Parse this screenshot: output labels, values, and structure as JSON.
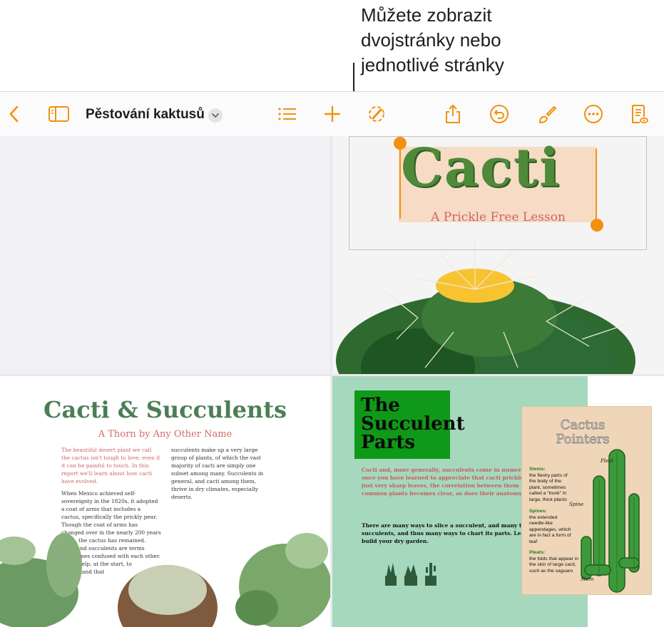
{
  "callout": {
    "lines": [
      "Můžete zobrazit",
      "dvojstránky nebo",
      "jednotlivé stránky"
    ]
  },
  "toolbar": {
    "title": "Pěstování kaktusů",
    "accent_color": "#f2910e",
    "icons": [
      "back-chevron-icon",
      "sidebar-icon",
      "chevron-down-icon",
      "list-icon",
      "plus-icon",
      "format-brush-icon",
      "share-icon",
      "undo-icon",
      "paintbrush-icon",
      "more-icon",
      "reading-view-icon"
    ]
  },
  "cover": {
    "title": "Cacti",
    "subtitle": "A Prickle Free Lesson"
  },
  "spread_left": {
    "title": "Cacti & Succulents",
    "subtitle": "A Thorn by Any Other Name",
    "intro": "The beautiful desert plant we call the cactus isn't tough to love, even if it can be painful to touch. In this report we'll learn about how cacti have evolved.",
    "col1": "When Mexico achieved self-sovereignty in the 1820s, it adopted a coat of arms that includes a cactus, specifically the prickly pear. Though the coat of arms has changed over in the nearly 200 years since, the cactus has remained. Cacti and succulents are terms sometimes confused with each other. It can help, at the start, to understand that",
    "col2": "succulents make up a very large group of plants, of which the vast majority of cacti are simply one subset among many. Succulents in general, and cacti among them, thrive in dry climates, especially deserts."
  },
  "spread_right": {
    "title_lines": [
      "The",
      "Succulent",
      "Parts"
    ],
    "intro": "Cacti and, more generally, succulents come in numerous forms, and, once you have learned to appreciate that cacti prickles are really just very sharp leaves, the correlation between them and more common plants becomes clear, as does their anatomy.",
    "body": "There are many ways to slice a succulent, and many types of succulents, and thus many ways to chart its parts. Learn how to build your dry garden.",
    "pointers": {
      "title_lines": [
        "Cactus",
        "Pointers"
      ],
      "items": [
        {
          "heading": "Stems:",
          "text": "the fleshy parts of the body of the plant, sometimes called a “trunk” in large, thick plants"
        },
        {
          "heading": "Spines:",
          "text": "the extended needle-like appendages, which are in fact a form of leaf"
        },
        {
          "heading": "Pleats:",
          "text": "the folds that appear in the skin of large cacti, such as the saguaro"
        }
      ],
      "labels": [
        "Pleat",
        "Spine",
        "Stem"
      ]
    }
  }
}
